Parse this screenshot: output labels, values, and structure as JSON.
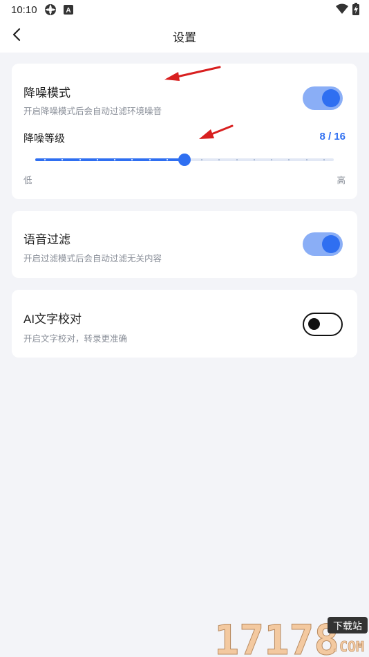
{
  "status_bar": {
    "time": "10:10",
    "icons_left": [
      "settings-gear-icon",
      "app-a-icon"
    ],
    "icons_right": [
      "wifi-icon",
      "battery-charging-icon"
    ],
    "app_icon_letter": "A"
  },
  "header": {
    "back_icon": "chevron-left-icon",
    "title": "设置"
  },
  "noise_reduction": {
    "title": "降噪模式",
    "description": "开启降噪模式后会自动过滤环境噪音",
    "enabled": true,
    "level_label": "降噪等级",
    "level_value_text": "8 / 16",
    "level_current": 8,
    "level_max": 16,
    "low_label": "低",
    "high_label": "高"
  },
  "voice_filter": {
    "title": "语音过滤",
    "description": "开启过滤模式后会自动过滤无关内容",
    "enabled": true
  },
  "ai_proofread": {
    "title": "AI文字校对",
    "description": "开启文字校对，转录更准确",
    "enabled": false
  },
  "watermark": {
    "text": "17178",
    "badge": "下载站",
    "domain": ".COM"
  },
  "colors": {
    "accent": "#2f6ff1",
    "toggle_on_bg": "#8aaef6",
    "page_bg": "#f3f4f8",
    "annotation_arrow": "#d81f1f"
  }
}
